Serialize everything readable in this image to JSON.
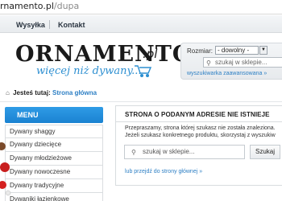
{
  "address_bar": {
    "host": "rnamento.pl",
    "path": "/dupa"
  },
  "top_nav": {
    "items": [
      "Wysyłka",
      "Kontakt"
    ]
  },
  "logo": {
    "brand": "ORNAMENTO",
    "tld": ".pl",
    "tagline": "więcej niż dywany..."
  },
  "header_search": {
    "size_label": "Rozmiar:",
    "size_selected": "- dowolny -",
    "placeholder": "szukaj w sklepie...",
    "advanced_link": "wyszukiwarka zaawansowana »"
  },
  "breadcrumb": {
    "label": "Jesteś tutaj:",
    "current": "Strona główna"
  },
  "sidebar": {
    "header": "MENU",
    "items": [
      "Dywany shaggy",
      "Dywany dziecięce",
      "Dywany młodzieżowe",
      "Dywany nowoczesne",
      "Dywany tradycyjne",
      "Dywaniki łazienkowe"
    ]
  },
  "error_panel": {
    "title": "STRONA O PODANYM ADRESIE NIE ISTNIEJE",
    "line1": "Przepraszamy, strona której szukasz nie została znaleziona.",
    "line2": "Jeżeli szukasz konkretnego produktu, skorzystaj z wyszukiw",
    "search_placeholder": "szukaj w sklepie...",
    "search_button": "Szukaj",
    "back_link": "lub przejdź do strony głównej »"
  },
  "icons": {
    "home": "home-icon",
    "search": "magnifier-icon",
    "cart": "shopping-cart-icon",
    "dropdown": "chevron-down-icon"
  },
  "colors": {
    "accent": "#2d8fd1",
    "menu_header": "#1f8ad6",
    "link": "#2d7fc4"
  }
}
